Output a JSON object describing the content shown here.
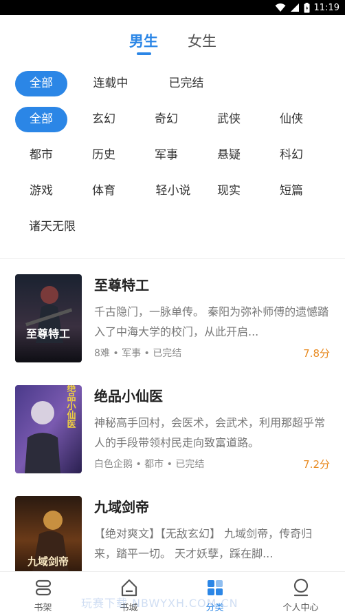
{
  "status_bar": {
    "time": "11:19"
  },
  "gender_tabs": [
    {
      "label": "男生",
      "active": true
    },
    {
      "label": "女生",
      "active": false
    }
  ],
  "status_filter": [
    "全部",
    "连载中",
    "已完结"
  ],
  "genre_filter": [
    "全部",
    "玄幻",
    "奇幻",
    "武侠",
    "仙侠",
    "都市",
    "历史",
    "军事",
    "悬疑",
    "科幻",
    "游戏",
    "体育",
    "轻小说",
    "现实",
    "短篇",
    "诸天无限"
  ],
  "books": [
    {
      "title": "至尊特工",
      "desc": "千古隐门，一脉单传。 秦阳为弥补师傅的遗憾踏入了中海大学的校门，从此开启...",
      "meta": "8难 • 军事 • 已完结",
      "score": "7.8分",
      "cover_text": "至尊特工"
    },
    {
      "title": "绝品小仙医",
      "desc": "神秘高手回村，会医术，会武术，利用那超乎常人的手段带领村民走向致富道路。",
      "meta": "白色企鹅 • 都市 • 已完结",
      "score": "7.2分",
      "cover_text": "绝品小仙医"
    },
    {
      "title": "九域剑帝",
      "desc": "【绝对爽文】【无敌玄幻】 九域剑帝，传奇归来，踏平一切。 天才妖孽，踩在脚...",
      "meta": "",
      "score": "",
      "cover_text": "九域剑帝"
    }
  ],
  "bottom_nav": [
    {
      "label": "书架",
      "icon": "bookshelf-icon",
      "active": false
    },
    {
      "label": "书城",
      "icon": "bookstore-icon",
      "active": false
    },
    {
      "label": "分类",
      "icon": "category-icon",
      "active": true
    },
    {
      "label": "个人中心",
      "icon": "profile-icon",
      "active": false
    }
  ],
  "watermark": "玩赛下载 NBWYXH.COM.CN",
  "colors": {
    "accent": "#2b86e6",
    "score": "#e8891e"
  }
}
